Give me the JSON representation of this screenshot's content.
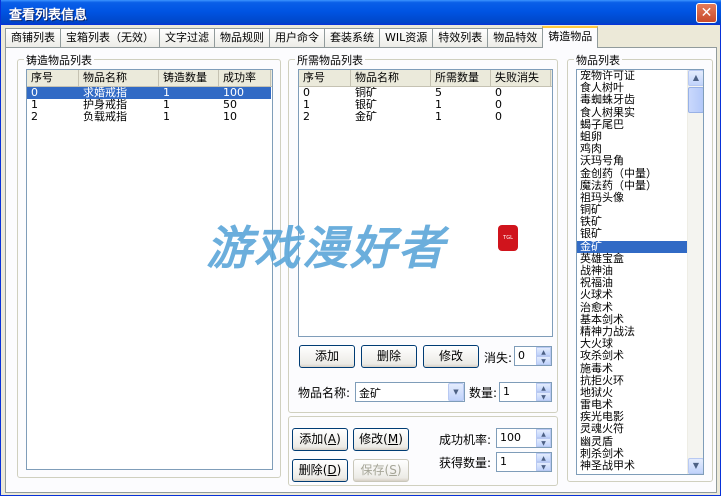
{
  "window": {
    "title": "查看列表信息"
  },
  "tabs": [
    "商铺列表",
    "宝箱列表（无效）",
    "文字过滤",
    "物品规则",
    "用户命令",
    "套装系统",
    "WIL资源",
    "特效列表",
    "物品特效",
    "铸造物品"
  ],
  "active_tab": 9,
  "forge_group": {
    "label": "铸造物品列表",
    "columns": [
      "序号",
      "物品名称",
      "铸造数量",
      "成功率"
    ],
    "rows": [
      [
        "0",
        "求婚戒指",
        "1",
        "100"
      ],
      [
        "1",
        "护身戒指",
        "1",
        "50"
      ],
      [
        "2",
        "负载戒指",
        "1",
        "10"
      ]
    ],
    "selected_row": 0
  },
  "required_group": {
    "label": "所需物品列表",
    "columns": [
      "序号",
      "物品名称",
      "所需数量",
      "失败消失"
    ],
    "rows": [
      [
        "0",
        "铜矿",
        "5",
        "0"
      ],
      [
        "1",
        "银矿",
        "1",
        "0"
      ],
      [
        "2",
        "金矿",
        "1",
        "0"
      ]
    ],
    "buttons": {
      "add": "添加",
      "delete": "删除",
      "modify": "修改"
    },
    "loss_label": "消失:",
    "loss_value": "0",
    "item_name_label": "物品名称:",
    "item_name_value": "金矿",
    "qty_label": "数量:",
    "qty_value": "1"
  },
  "bottom": {
    "add": "添加",
    "add_key": "A",
    "modify": "修改",
    "modify_key": "M",
    "delete": "删除",
    "delete_key": "D",
    "save": "保存",
    "save_key": "S",
    "success_label": "成功机率:",
    "success_value": "100",
    "gain_label": "获得数量:",
    "gain_value": "1"
  },
  "items_group": {
    "label": "物品列表",
    "items": [
      "宠物许可证",
      "食人树叶",
      "毒蜘蛛牙齿",
      "食人树果实",
      "蝎子尾巴",
      "蛆卵",
      "鸡肉",
      "沃玛号角",
      "金创药（中量）",
      "魔法药（中量）",
      "祖玛头像",
      "铜矿",
      "铁矿",
      "银矿",
      "金矿",
      "英雄宝盒",
      "战神油",
      "祝福油",
      "火球术",
      "治愈术",
      "基本剑术",
      "精神力战法",
      "大火球",
      "攻杀剑术",
      "施毒术",
      "抗拒火环",
      "地狱火",
      "雷电术",
      "疾光电影",
      "灵魂火符",
      "幽灵盾",
      "刺杀剑术",
      "神圣战甲术"
    ],
    "selected": 14
  },
  "watermark": {
    "text": "游戏漫好者",
    "seal": "TGL"
  }
}
